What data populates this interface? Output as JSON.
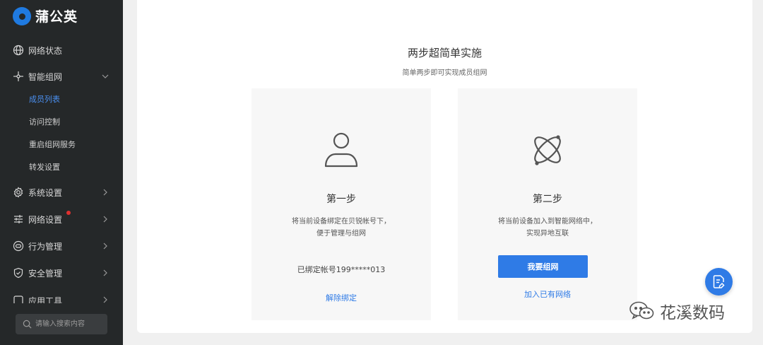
{
  "brand": {
    "name": "蒲公英",
    "color": "#1f7ae0"
  },
  "sidebar": {
    "items": [
      {
        "label": "网络状态",
        "icon": "globe-icon"
      },
      {
        "label": "智能组网",
        "icon": "network-icon",
        "expanded": true,
        "children": [
          {
            "label": "成员列表",
            "active": true
          },
          {
            "label": "访问控制"
          },
          {
            "label": "重启组网服务"
          },
          {
            "label": "转发设置"
          }
        ]
      },
      {
        "label": "系统设置",
        "icon": "gear-icon"
      },
      {
        "label": "网络设置",
        "icon": "sliders-icon",
        "badge": "red-dot"
      },
      {
        "label": "行为管理",
        "icon": "behavior-icon"
      },
      {
        "label": "安全管理",
        "icon": "shield-icon"
      },
      {
        "label": "应用工具",
        "icon": "tools-icon"
      }
    ],
    "search": {
      "placeholder": "请输入搜索内容"
    }
  },
  "main": {
    "title": "两步超简单实施",
    "subtitle": "简单两步即可实现成员组网",
    "step1": {
      "title": "第一步",
      "desc_line1": "将当前设备绑定在贝锐帐号下，",
      "desc_line2": "便于管理与组网",
      "bound_text": "已绑定帐号199*****013",
      "link": "解除绑定",
      "icon": "user-icon"
    },
    "step2": {
      "title": "第二步",
      "desc_line1": "将当前设备加入到智能网络中，",
      "desc_line2": "实现异地互联",
      "button": "我要组网",
      "link": "加入已有网络",
      "icon": "orbit-icon"
    }
  },
  "watermark": {
    "text": "花溪数码"
  },
  "colors": {
    "accent": "#2f7be6",
    "sidebar_bg": "#252829",
    "badge": "#e0302f"
  }
}
